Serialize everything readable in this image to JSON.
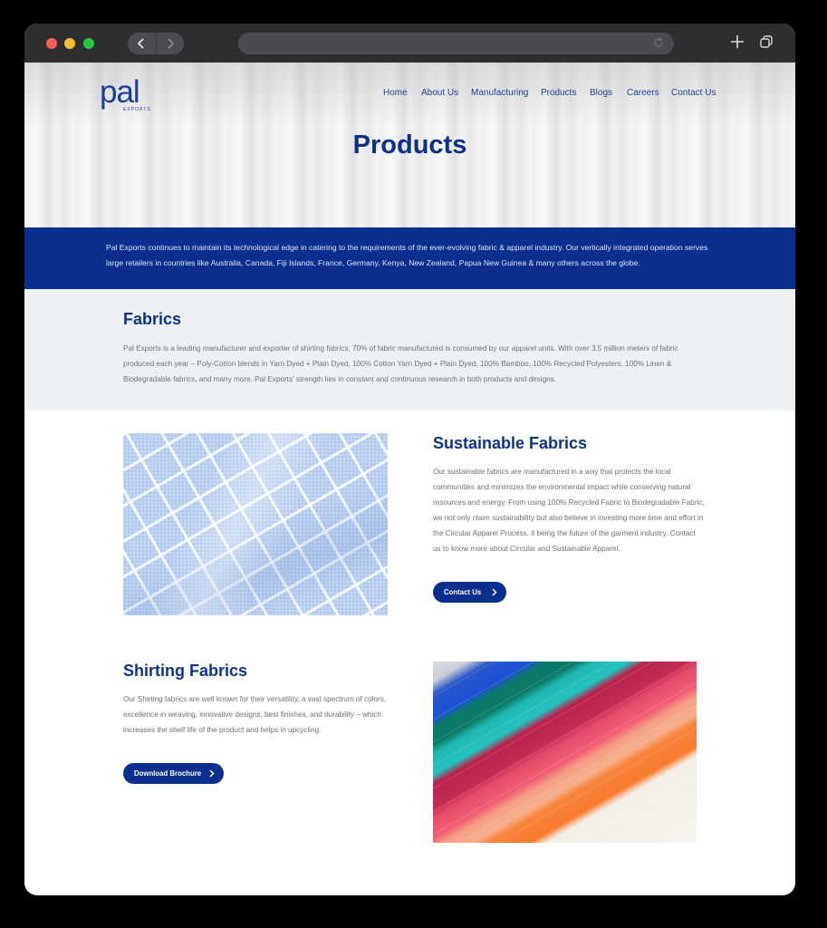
{
  "nav": {
    "items": [
      {
        "label": "Home"
      },
      {
        "label": "About Us"
      },
      {
        "label": "Manufacturing"
      },
      {
        "label": "Products"
      },
      {
        "label": "Blogs"
      },
      {
        "label": "Careers"
      },
      {
        "label": "Contact Us"
      }
    ]
  },
  "logo": {
    "text": "pal",
    "sub": "EXPORTS"
  },
  "hero": {
    "title": "Products"
  },
  "intro": {
    "text": "Pal Exports continues to maintain its technological edge in catering to the requirements of the ever-evolving fabric & apparel industry. Our vertically integrated operation serves large retailers in countries like Australia, Canada, Fiji Islands, France, Germany, Kenya, New Zealand, Papua New Guinea & many others across the globe."
  },
  "fabrics": {
    "title": "Fabrics",
    "text": "Pal Exports is a leading manufacturer and exporter of shirting fabrics; 70% of fabric manufactured is consumed by our apparel units. With over 3.5 million meters of fabric produced each year – Poly-Cotton blends in Yarn Dyed + Plain Dyed, 100% Cotton Yarn Dyed + Plain Dyed, 100% Bamboo, 100% Recycled Polyesters, 100% Linen & Biodegradable fabrics, and many more. Pal Exports' strength lies in constant and continuous research in both products and designs."
  },
  "sustainable": {
    "title": "Sustainable Fabrics",
    "text": "Our sustainable fabrics are manufactured in a way that protects the local communities and minimizes the environmental impact while conserving natural resources and energy. From using 100% Recycled Fabric to Biodegradable Fabric, we not only claim sustainability but also believe in investing more time and effort in the Circular Apparel Process, it being the future of the garment industry. Contact us to know more about Circular and Sustainable Apparel.",
    "button": "Contact Us"
  },
  "shirting": {
    "title": "Shirting Fabrics",
    "text": "Our Shirting fabrics are well known for their versatility, a vast spectrum of colors, excellence in weaving, innovative designs, best finishes, and durability – which increases the shelf life of the product and helps in upcycling.",
    "button": "Download Brochure"
  },
  "colors": {
    "brand_blue": "#0b2f8f",
    "heading_blue": "#0c3489"
  }
}
